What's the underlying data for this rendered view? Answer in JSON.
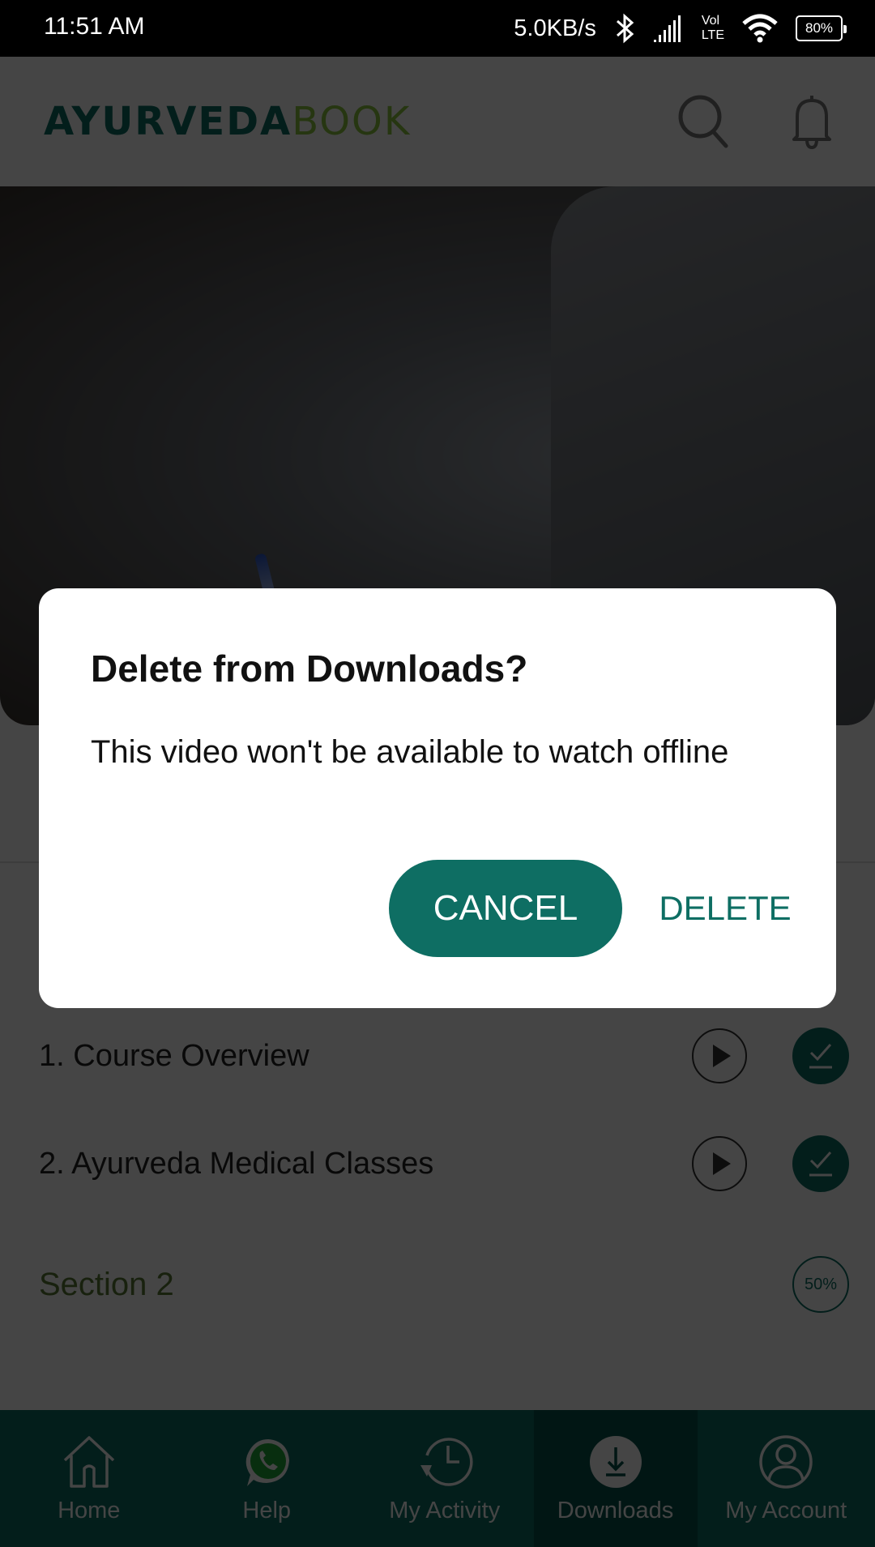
{
  "status_bar": {
    "time": "11:51 AM",
    "network_speed": "5.0KB/s",
    "volte_line1": "Vol",
    "volte_line2": "LTE",
    "battery": "80%"
  },
  "header": {
    "logo_part1": "AYURVEDA",
    "logo_part2": "BOOK",
    "search_icon": "search-icon",
    "notifications_icon": "bell-icon"
  },
  "lessons": [
    {
      "title": "1. Course Overview",
      "downloaded": true
    },
    {
      "title": "2. Ayurveda Medical Classes",
      "downloaded": true
    }
  ],
  "section": {
    "title": "Section 2",
    "progress": "50%"
  },
  "dialog": {
    "title": "Delete from Downloads?",
    "message": "This video won't be available to watch offline",
    "cancel_label": "CANCEL",
    "delete_label": "DELETE"
  },
  "bottom_nav": {
    "items": [
      {
        "label": "Home",
        "icon": "home-icon"
      },
      {
        "label": "Help",
        "icon": "whatsapp-icon"
      },
      {
        "label": "My Activity",
        "icon": "history-icon"
      },
      {
        "label": "Downloads",
        "icon": "download-icon",
        "active": true
      },
      {
        "label": "My Account",
        "icon": "account-icon"
      }
    ]
  },
  "colors": {
    "brand_primary": "#0e6e63",
    "brand_secondary": "#8cc63f",
    "nav_active": "#07544b"
  }
}
